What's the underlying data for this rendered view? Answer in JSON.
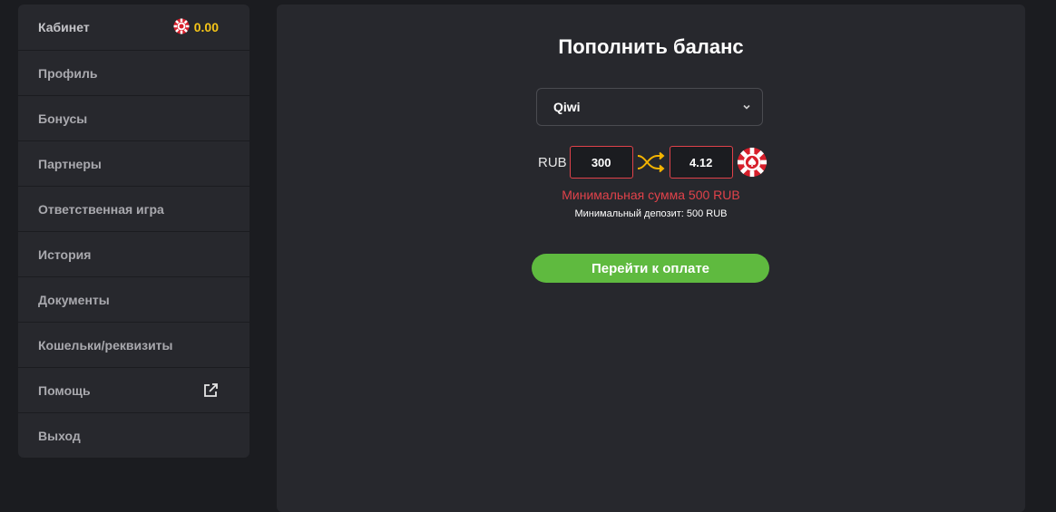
{
  "sidebar": {
    "items": [
      {
        "label": "Кабинет"
      },
      {
        "label": "Профиль"
      },
      {
        "label": "Бонусы"
      },
      {
        "label": "Партнеры"
      },
      {
        "label": "Ответственная игра"
      },
      {
        "label": "История"
      },
      {
        "label": "Документы"
      },
      {
        "label": "Кошельки/реквизиты"
      },
      {
        "label": "Помощь"
      },
      {
        "label": "Выход"
      }
    ],
    "balance": "0.00",
    "balance_icon": "chip-icon",
    "help_icon": "external-link-icon"
  },
  "deposit": {
    "title": "Пополнить баланс",
    "method": "Qiwi",
    "currency": "RUB",
    "amount": "300",
    "converted": "4.12",
    "error": "Минимальная сумма 500 RUB",
    "hint": "Минимальный депозит: 500 RUB",
    "button": "Перейти к оплате"
  },
  "colors": {
    "accent_green": "#5fba3f",
    "error_red": "#e0424a",
    "balance_gold": "#f5c518",
    "panel": "#27282d",
    "background": "#1b1c20"
  }
}
